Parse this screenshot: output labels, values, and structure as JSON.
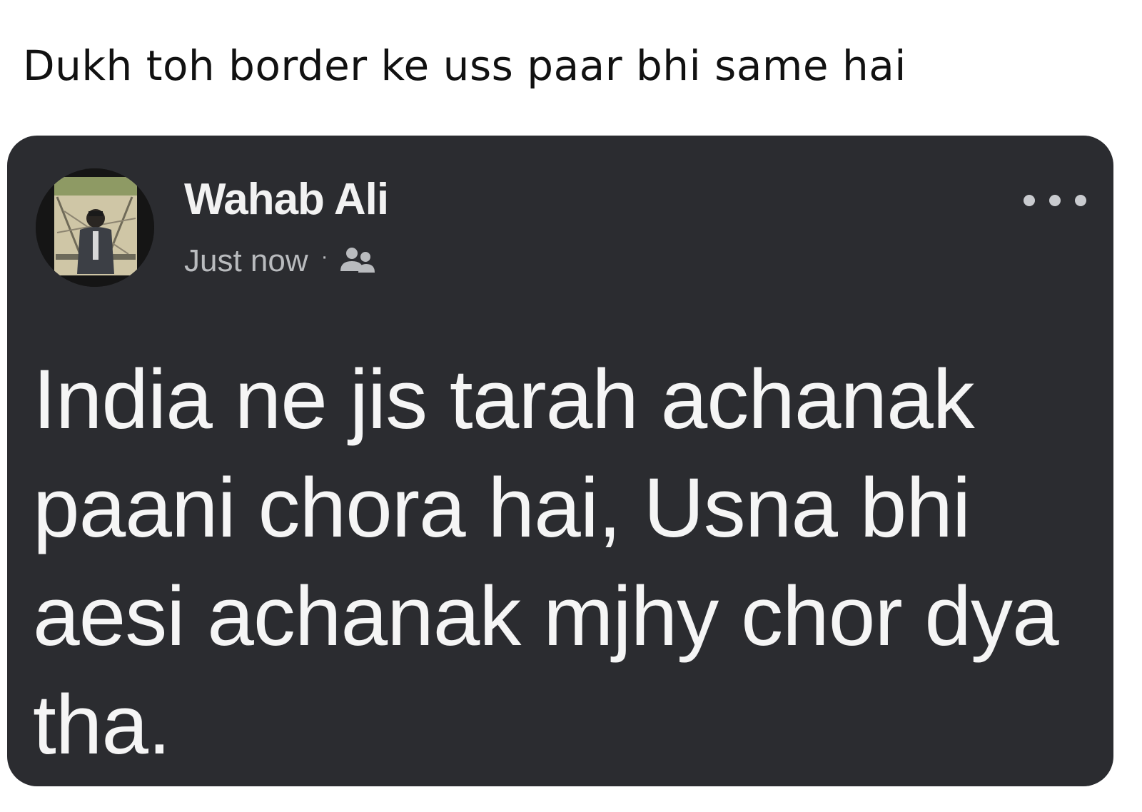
{
  "caption": "Dukh toh border ke uss paar bhi same hai",
  "post": {
    "author_name": "Wahab Ali",
    "timestamp": "Just now",
    "separator": "·",
    "audience_icon": "friends-icon",
    "more_icon": "more-options-icon",
    "text": "India ne jis tarah achanak paani chora hai, Usna bhi aesi achanak mjhy chor dya tha."
  },
  "colors": {
    "card_background": "#2b2c30",
    "post_text": "#f5f5f5",
    "meta_text": "#b9bbbe",
    "page_background": "#ffffff"
  }
}
